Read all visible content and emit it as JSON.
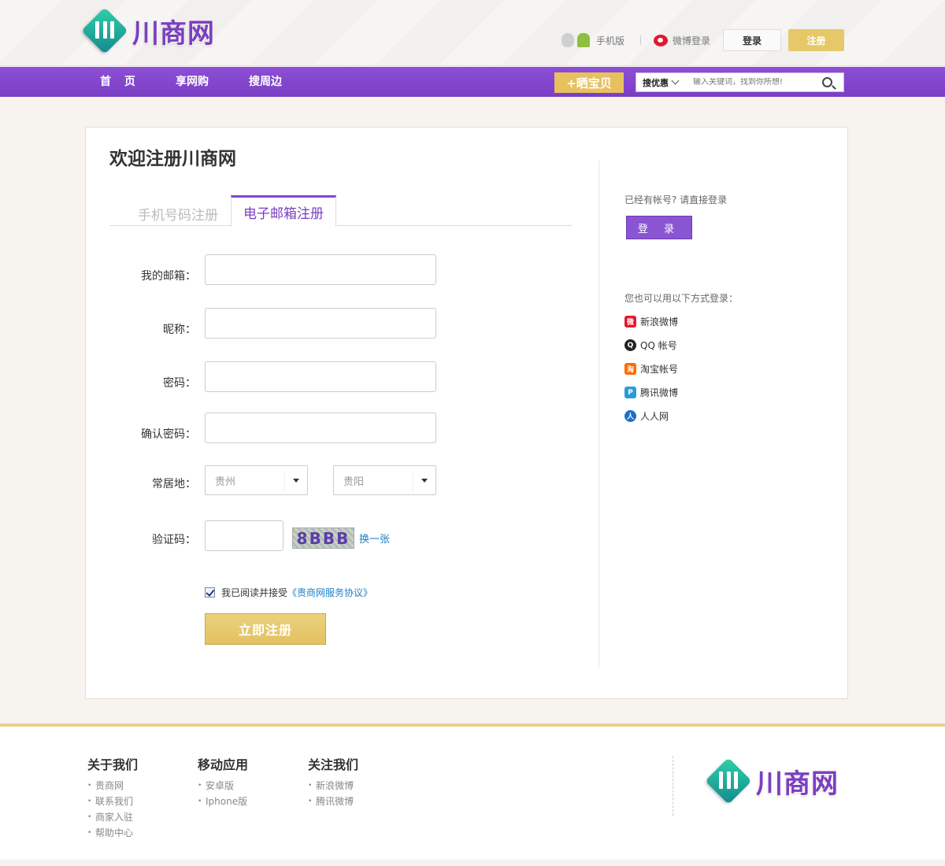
{
  "header": {
    "logo_text": "川商网",
    "mobile_label": "手机版",
    "weibo_login_label": "微博登录",
    "login_label": "登录",
    "register_label": "注册"
  },
  "nav": {
    "items": [
      "首 页",
      "享网购",
      "搜周边"
    ],
    "share_label": "+晒宝贝",
    "search_category": "搜优惠",
    "search_placeholder": "输入关键词，找到你所想!"
  },
  "main": {
    "title": "欢迎注册川商网",
    "tabs": [
      {
        "label": "手机号码注册",
        "active": false
      },
      {
        "label": "电子邮箱注册",
        "active": true
      }
    ],
    "form": {
      "email_label": "我的邮箱：",
      "nickname_label": "昵称：",
      "password_label": "密码：",
      "confirm_label": "确认密码：",
      "residence_label": "常居地：",
      "province_value": "贵州",
      "city_value": "贵阳",
      "captcha_label": "验证码：",
      "captcha_image_text": "8BBB",
      "captcha_refresh": "换一张",
      "agree_text": "我已阅读并接受",
      "agree_link": "《贵商网服务协议》",
      "submit_label": "立即注册"
    },
    "side": {
      "have_account": "已经有帐号? 请直接登录",
      "login_button": "登 录",
      "alt_login": "您也可以用以下方式登录：",
      "providers": [
        {
          "name": "新浪微博",
          "icon": "sina-weibo-icon",
          "color": "#e6162d"
        },
        {
          "name": "QQ 帐号",
          "icon": "qq-icon",
          "color": "#222222"
        },
        {
          "name": "淘宝帐号",
          "icon": "taobao-icon",
          "color": "#ff6a00"
        },
        {
          "name": "腾讯微博",
          "icon": "tencent-weibo-icon",
          "color": "#2a9bd7"
        },
        {
          "name": "人人网",
          "icon": "renren-icon",
          "color": "#1e6fc8"
        }
      ]
    }
  },
  "footer": {
    "about": {
      "title": "关于我们",
      "items": [
        "贵商网",
        "联系我们",
        "商家入驻",
        "帮助中心"
      ]
    },
    "apps": {
      "title": "移动应用",
      "items": [
        "安卓版",
        "Iphone版"
      ]
    },
    "follow": {
      "title": "关注我们",
      "items": [
        "新浪微博",
        "腾讯微博"
      ]
    },
    "logo_text": "川商网"
  },
  "colors": {
    "brand_purple": "#7a3ec4",
    "gold": "#e6c868"
  }
}
